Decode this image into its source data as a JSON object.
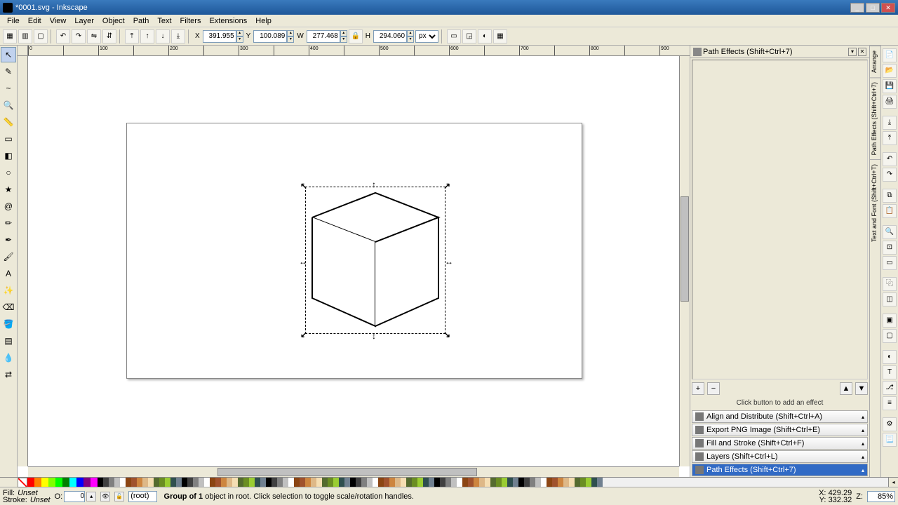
{
  "window": {
    "title": "*0001.svg - Inkscape"
  },
  "menu": [
    "File",
    "Edit",
    "View",
    "Layer",
    "Object",
    "Path",
    "Text",
    "Filters",
    "Extensions",
    "Help"
  ],
  "toolbar": {
    "x_label": "X",
    "x": "391.955",
    "y_label": "Y",
    "y": "100.089",
    "w_label": "W",
    "w": "277.468",
    "h_label": "H",
    "h": "294.060",
    "units": "px"
  },
  "ltools": [
    {
      "name": "selector",
      "glyph": "↖"
    },
    {
      "name": "node",
      "glyph": "✎"
    },
    {
      "name": "tweak",
      "glyph": "~"
    },
    {
      "name": "zoom",
      "glyph": "🔍"
    },
    {
      "name": "measure",
      "glyph": "📏"
    },
    {
      "name": "rect",
      "glyph": "▭"
    },
    {
      "name": "3dbox",
      "glyph": "◧"
    },
    {
      "name": "ellipse",
      "glyph": "○"
    },
    {
      "name": "star",
      "glyph": "★"
    },
    {
      "name": "spiral",
      "glyph": "@"
    },
    {
      "name": "pencil",
      "glyph": "✏"
    },
    {
      "name": "bezier",
      "glyph": "✒"
    },
    {
      "name": "calligraphy",
      "glyph": "🖌"
    },
    {
      "name": "text",
      "glyph": "A"
    },
    {
      "name": "spray",
      "glyph": "✨"
    },
    {
      "name": "eraser",
      "glyph": "⌫"
    },
    {
      "name": "bucket",
      "glyph": "🪣"
    },
    {
      "name": "gradient",
      "glyph": "▤"
    },
    {
      "name": "dropper",
      "glyph": "💧"
    },
    {
      "name": "connector",
      "glyph": "⇄"
    }
  ],
  "dock": {
    "active_title": "Path Effects  (Shift+Ctrl+7)",
    "msg": "Click button to add an effect",
    "items": [
      {
        "label": "Align and Distribute (Shift+Ctrl+A)"
      },
      {
        "label": "Export PNG Image (Shift+Ctrl+E)"
      },
      {
        "label": "Fill and Stroke (Shift+Ctrl+F)"
      },
      {
        "label": "Layers (Shift+Ctrl+L)"
      },
      {
        "label": "Path Effects  (Shift+Ctrl+7)"
      }
    ],
    "sel_index": 4
  },
  "vtabs": [
    "Arrange",
    "Path Effects (Shift+Ctrl+7)",
    "Text and Font (Shift+Ctrl+T)"
  ],
  "palette_basic": [
    "#ff0000",
    "#ff8000",
    "#ffff00",
    "#80ff00",
    "#00ff00",
    "#008000",
    "#00ffff",
    "#0000ff",
    "#800080",
    "#ff00ff"
  ],
  "status": {
    "fill": "Fill:",
    "stroke": "Stroke:",
    "unset": "Unset",
    "o_label": "O:",
    "o": "0",
    "layer": "(root)",
    "msg_pre": "Group of ",
    "count": "1",
    "msg_post": " object in root. Click selection to toggle scale/rotation handles.",
    "xl": "X:",
    "xv": "429.29",
    "yl": "Y:",
    "yv": "332.32",
    "zl": "Z:",
    "zoom": "85%"
  }
}
